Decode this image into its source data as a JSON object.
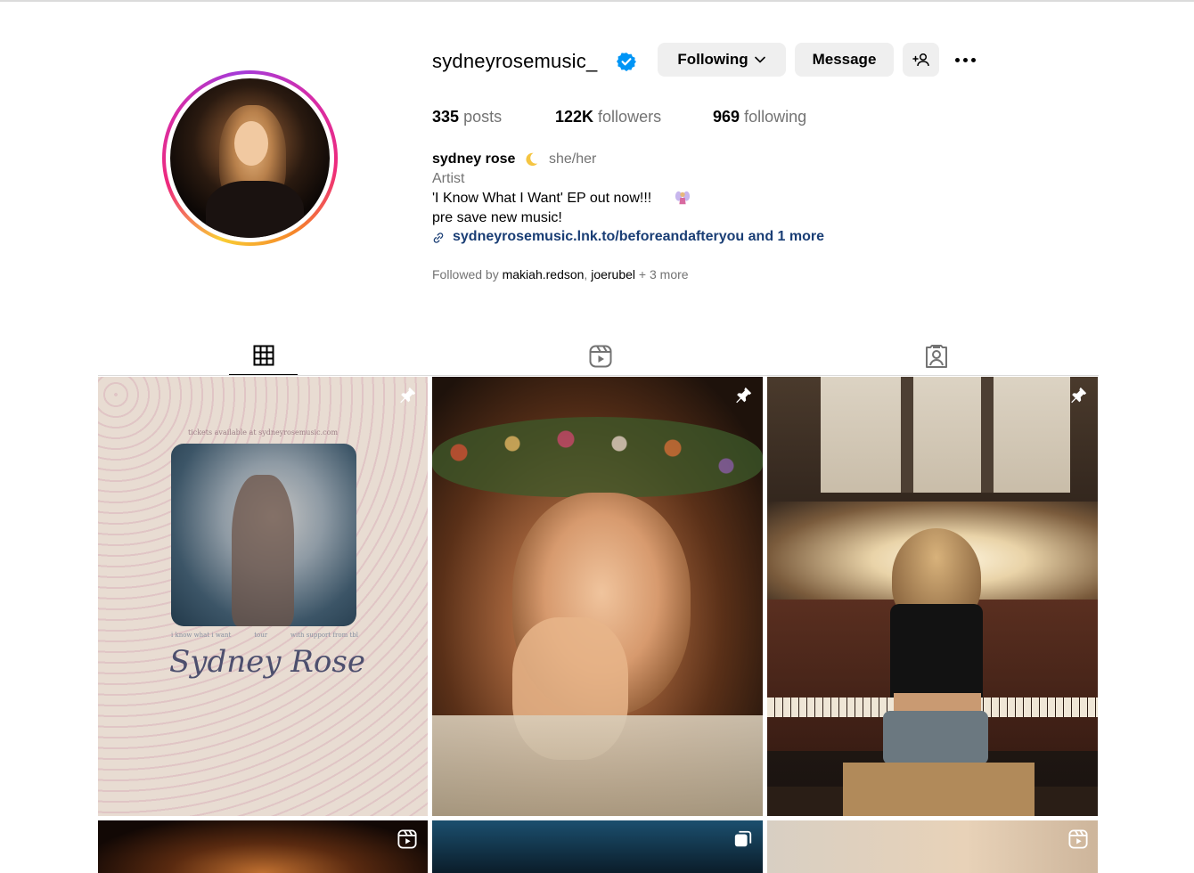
{
  "profile": {
    "username": "sydneyrosemusic_",
    "verified": true,
    "buttons": {
      "following": "Following",
      "message": "Message"
    },
    "stats": {
      "posts_count": "335",
      "posts_label": "posts",
      "followers_count": "122K",
      "followers_label": "followers",
      "following_count": "969",
      "following_label": "following"
    },
    "full_name": "sydney rose",
    "name_emoji": "crescent-moon-icon",
    "pronouns": "she/her",
    "category": "Artist",
    "bio_line1": "'I Know What I Want' EP out now!!!",
    "bio_emoji": "fairy-icon",
    "bio_line2": "pre save new music!",
    "link": "sydneyrosemusic.lnk.to/beforeandafteryou and 1 more",
    "followed_by": {
      "prefix": "Followed by",
      "user1": "makiah.redson",
      "separator": ",",
      "user2": "joerubel",
      "suffix": "+ 3 more"
    }
  },
  "tabs": [
    {
      "name": "posts",
      "icon": "grid-icon",
      "active": true
    },
    {
      "name": "reels",
      "icon": "reels-icon",
      "active": false
    },
    {
      "name": "tagged",
      "icon": "tagged-icon",
      "active": false
    }
  ],
  "posts": [
    {
      "pinned": true,
      "type": "image",
      "poster_text": {
        "tickets": "tickets available at sydneyrosemusic.com",
        "row_left": "i know what i want",
        "row_mid": "tour",
        "row_right": "with support from tbl",
        "signature": "Sydney Rose"
      }
    },
    {
      "pinned": true,
      "type": "image"
    },
    {
      "pinned": true,
      "type": "image"
    },
    {
      "pinned": false,
      "type": "reel"
    },
    {
      "pinned": false,
      "type": "carousel"
    },
    {
      "pinned": false,
      "type": "reel"
    }
  ],
  "colors": {
    "link": "#1a3e75",
    "verified": "#0095f6",
    "button_bg": "#efefef",
    "muted_text": "#737373"
  }
}
